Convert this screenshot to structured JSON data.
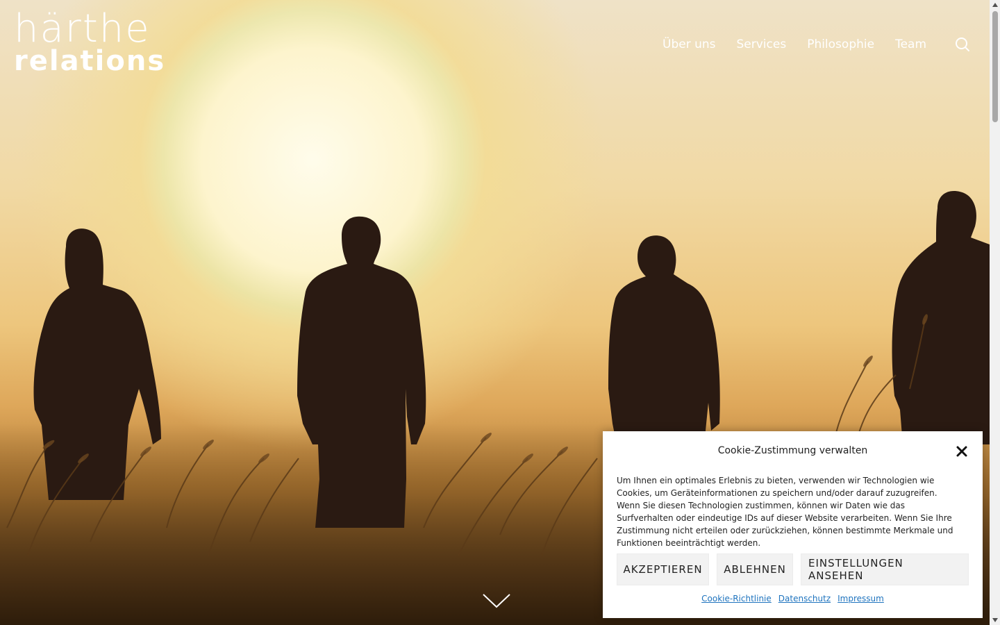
{
  "logo": {
    "line1": "härthe",
    "line2": "relations"
  },
  "nav": {
    "items": [
      {
        "label": "Über uns"
      },
      {
        "label": "Services"
      },
      {
        "label": "Philosophie"
      },
      {
        "label": "Team"
      }
    ],
    "search_icon": "search-icon"
  },
  "hero": {
    "scroll_icon": "chevron-down-icon"
  },
  "cookie": {
    "title": "Cookie-Zustimmung verwalten",
    "text": "Um Ihnen ein optimales Erlebnis zu bieten, verwenden wir Technologien wie Cookies, um Geräteinformationen zu speichern und/oder darauf zuzugreifen. Wenn Sie diesen Technologien zustimmen, können wir Daten wie das Surfverhalten oder eindeutige IDs auf dieser Website verarbeiten. Wenn Sie Ihre Zustimmung nicht erteilen oder zurückziehen, können bestimmte Merkmale und Funktionen beeinträchtigt werden.",
    "buttons": {
      "accept": "AKZEPTIEREN",
      "deny": "ABLEHNEN",
      "settings": "EINSTELLUNGEN ANSEHEN"
    },
    "links": {
      "cookie_policy": "Cookie-Richtlinie",
      "privacy": "Datenschutz",
      "imprint": "Impressum"
    },
    "close_icon": "close-icon"
  }
}
